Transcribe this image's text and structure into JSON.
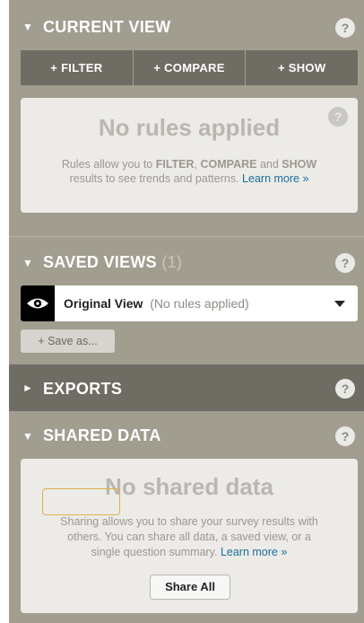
{
  "current_view": {
    "title": "CURRENT VIEW",
    "arrow": "▼",
    "help": "?",
    "buttons": [
      "+ FILTER",
      "+ COMPARE",
      "+ SHOW"
    ],
    "card": {
      "heading": "No rules applied",
      "help": "?",
      "desc_line1_a": "Rules allow you to ",
      "desc_filter": "FILTER",
      "desc_line1_b": ", ",
      "desc_compare": "COMPARE",
      "desc_line1_c": " and ",
      "desc_show": "SHOW",
      "desc_line2": "results to see trends and patterns. ",
      "learn_more": "Learn more »"
    }
  },
  "saved_views": {
    "title": "SAVED VIEWS",
    "count": "(1)",
    "arrow": "▼",
    "help": "?",
    "selected_view": "Original View",
    "selected_note": "(No rules applied)",
    "save_as": "+ Save as..."
  },
  "exports": {
    "title": "EXPORTS",
    "arrow": "►",
    "help": "?"
  },
  "shared_data": {
    "title": "SHARED DATA",
    "arrow": "▼",
    "help": "?",
    "card": {
      "heading": "No shared data",
      "desc_line1": "Sharing allows you to share your survey results with",
      "desc_line2": "others. You can share all data, a saved view, or a",
      "desc_line3": "single question summary. ",
      "learn_more": "Learn more »",
      "share_all": "Share All"
    }
  }
}
